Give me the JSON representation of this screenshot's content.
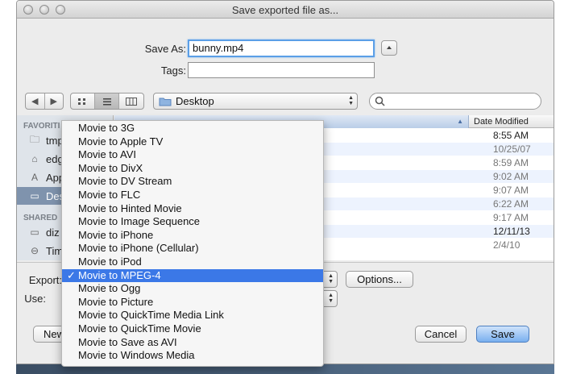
{
  "window": {
    "title": "Save exported file as..."
  },
  "save_as": {
    "label": "Save As:",
    "value": "bunny.mp4"
  },
  "tags": {
    "label": "Tags:",
    "value": ""
  },
  "toolbar": {
    "back_icon": "chevron-left-icon",
    "forward_icon": "chevron-right-icon",
    "view_modes": [
      "icon-view",
      "list-view",
      "column-view"
    ],
    "location": "Desktop",
    "search_placeholder": ""
  },
  "sidebar": {
    "favorites_heading": "FAVORITI",
    "favorites": [
      {
        "label": "tmp",
        "icon": "folder-icon"
      },
      {
        "label": "edg",
        "icon": "home-icon"
      },
      {
        "label": "App",
        "icon": "apps-icon"
      },
      {
        "label": "Des",
        "icon": "desktop-icon",
        "selected": true
      }
    ],
    "shared_heading": "SHARED",
    "shared": [
      {
        "label": "diz",
        "icon": "computer-icon"
      },
      {
        "label": "Tim",
        "icon": "disk-icon"
      }
    ]
  },
  "file_list": {
    "column_date": "Date Modified",
    "dates": [
      "8:55 AM",
      "10/25/07",
      "8:59 AM",
      "9:02 AM",
      "9:07 AM",
      "6:22 AM",
      "9:17 AM",
      "12/11/13",
      "2/4/10"
    ]
  },
  "export": {
    "label": "Export:",
    "options_label": "Options..."
  },
  "use": {
    "label": "Use:"
  },
  "buttons": {
    "new_folder": "New",
    "cancel": "Cancel",
    "save": "Save"
  },
  "export_menu": {
    "items": [
      "Movie to 3G",
      "Movie to Apple TV",
      "Movie to AVI",
      "Movie to DivX",
      "Movie to DV Stream",
      "Movie to FLC",
      "Movie to Hinted Movie",
      "Movie to Image Sequence",
      "Movie to iPhone",
      "Movie to iPhone (Cellular)",
      "Movie to iPod",
      "Movie to MPEG-4",
      "Movie to Ogg",
      "Movie to Picture",
      "Movie to QuickTime Media Link",
      "Movie to QuickTime Movie",
      "Movie to Save as AVI",
      "Movie to Windows Media"
    ],
    "selected_index": 11,
    "check_mark": "✓"
  }
}
